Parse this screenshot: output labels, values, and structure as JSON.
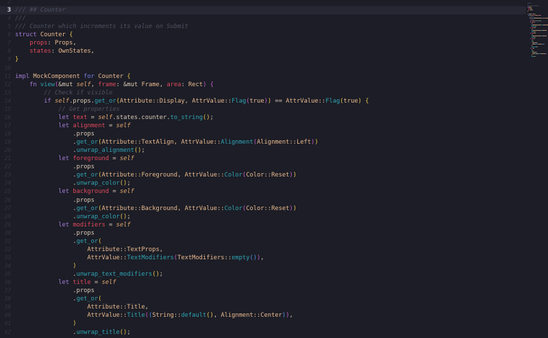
{
  "editor": {
    "current_line": 3,
    "lines": [
      {
        "n": "2",
        "tokens": []
      },
      {
        "n": "3",
        "tokens": [
          [
            "c",
            "/// ## Counter"
          ]
        ]
      },
      {
        "n": "4",
        "tokens": [
          [
            "c",
            "///"
          ]
        ]
      },
      {
        "n": "5",
        "tokens": [
          [
            "c",
            "/// Counter which increments its value on Submit"
          ]
        ]
      },
      {
        "n": "6",
        "tokens": [
          [
            "k",
            "struct"
          ],
          [
            "p",
            " "
          ],
          [
            "t",
            "Counter"
          ],
          [
            "p",
            " "
          ],
          [
            "b1",
            "{"
          ]
        ]
      },
      {
        "n": "7",
        "tokens": [
          [
            "p",
            "    "
          ],
          [
            "f",
            "props"
          ],
          [
            "p",
            ": "
          ],
          [
            "t",
            "Props"
          ],
          [
            "p",
            ","
          ]
        ]
      },
      {
        "n": "8",
        "tokens": [
          [
            "p",
            "    "
          ],
          [
            "f",
            "states"
          ],
          [
            "p",
            ": "
          ],
          [
            "t",
            "OwnStates"
          ],
          [
            "p",
            ","
          ]
        ]
      },
      {
        "n": "9",
        "tokens": [
          [
            "b1",
            "}"
          ]
        ]
      },
      {
        "n": "10",
        "tokens": []
      },
      {
        "n": "11",
        "tokens": [
          [
            "k",
            "impl"
          ],
          [
            "p",
            " "
          ],
          [
            "t",
            "MockComponent"
          ],
          [
            "p",
            " "
          ],
          [
            "k2",
            "for"
          ],
          [
            "p",
            " "
          ],
          [
            "t",
            "Counter"
          ],
          [
            "p",
            " "
          ],
          [
            "b1",
            "{"
          ]
        ]
      },
      {
        "n": "12",
        "tokens": [
          [
            "p",
            "    "
          ],
          [
            "k",
            "fn"
          ],
          [
            "p",
            " "
          ],
          [
            "m",
            "view"
          ],
          [
            "b2",
            "("
          ],
          [
            "p",
            "&mut "
          ],
          [
            "s",
            "self"
          ],
          [
            "p",
            ", "
          ],
          [
            "f",
            "frame"
          ],
          [
            "p",
            ": &mut "
          ],
          [
            "t",
            "Frame"
          ],
          [
            "p",
            ", "
          ],
          [
            "f",
            "area"
          ],
          [
            "p",
            ": "
          ],
          [
            "t",
            "Rect"
          ],
          [
            "b2",
            ")"
          ],
          [
            "p",
            " "
          ],
          [
            "b2",
            "{"
          ]
        ]
      },
      {
        "n": "13",
        "tokens": [
          [
            "p",
            "        "
          ],
          [
            "c",
            "// Check if visible"
          ]
        ]
      },
      {
        "n": "14",
        "tokens": [
          [
            "p",
            "        "
          ],
          [
            "k",
            "if"
          ],
          [
            "p",
            " "
          ],
          [
            "s",
            "self"
          ],
          [
            "p",
            ".props."
          ],
          [
            "m",
            "get_or"
          ],
          [
            "b1",
            "("
          ],
          [
            "t",
            "Attribute::Display, AttrValue::"
          ],
          [
            "m",
            "Flag"
          ],
          [
            "b2",
            "("
          ],
          [
            "t",
            "true"
          ],
          [
            "b2",
            ")"
          ],
          [
            "b1",
            ")"
          ],
          [
            "p",
            " == "
          ],
          [
            "t",
            "AttrValue::"
          ],
          [
            "m",
            "Flag"
          ],
          [
            "b1",
            "("
          ],
          [
            "t",
            "true"
          ],
          [
            "b1",
            ")"
          ],
          [
            "p",
            " "
          ],
          [
            "b1",
            "{"
          ]
        ]
      },
      {
        "n": "15",
        "tokens": [
          [
            "p",
            "            "
          ],
          [
            "c",
            "// Get properties"
          ]
        ]
      },
      {
        "n": "16",
        "tokens": [
          [
            "p",
            "            "
          ],
          [
            "k",
            "let"
          ],
          [
            "p",
            " "
          ],
          [
            "f",
            "text"
          ],
          [
            "p",
            " = "
          ],
          [
            "s",
            "self"
          ],
          [
            "p",
            ".states.counter."
          ],
          [
            "m",
            "to_string"
          ],
          [
            "b1",
            "()"
          ],
          [
            "p",
            ";"
          ]
        ]
      },
      {
        "n": "17",
        "tokens": [
          [
            "p",
            "            "
          ],
          [
            "k",
            "let"
          ],
          [
            "p",
            " "
          ],
          [
            "f",
            "alignment"
          ],
          [
            "p",
            " = "
          ],
          [
            "s",
            "self"
          ]
        ]
      },
      {
        "n": "18",
        "tokens": [
          [
            "p",
            "                .props"
          ]
        ]
      },
      {
        "n": "19",
        "tokens": [
          [
            "p",
            "                ."
          ],
          [
            "m",
            "get_or"
          ],
          [
            "b1",
            "("
          ],
          [
            "t",
            "Attribute::TextAlign, AttrValue::"
          ],
          [
            "m",
            "Alignment"
          ],
          [
            "b2",
            "("
          ],
          [
            "t",
            "Alignment::Left"
          ],
          [
            "b2",
            ")"
          ],
          [
            "b1",
            ")"
          ]
        ]
      },
      {
        "n": "20",
        "tokens": [
          [
            "p",
            "                ."
          ],
          [
            "m",
            "unwrap_alignment"
          ],
          [
            "b1",
            "()"
          ],
          [
            "p",
            ";"
          ]
        ]
      },
      {
        "n": "21",
        "tokens": [
          [
            "p",
            "            "
          ],
          [
            "k",
            "let"
          ],
          [
            "p",
            " "
          ],
          [
            "f",
            "foreground"
          ],
          [
            "p",
            " = "
          ],
          [
            "s",
            "self"
          ]
        ]
      },
      {
        "n": "22",
        "tokens": [
          [
            "p",
            "                .props"
          ]
        ]
      },
      {
        "n": "23",
        "tokens": [
          [
            "p",
            "                ."
          ],
          [
            "m",
            "get_or"
          ],
          [
            "b1",
            "("
          ],
          [
            "t",
            "Attribute::Foreground, AttrValue::"
          ],
          [
            "m",
            "Color"
          ],
          [
            "b2",
            "("
          ],
          [
            "t",
            "Color::Reset"
          ],
          [
            "b2",
            ")"
          ],
          [
            "b1",
            ")"
          ]
        ]
      },
      {
        "n": "24",
        "tokens": [
          [
            "p",
            "                ."
          ],
          [
            "m",
            "unwrap_color"
          ],
          [
            "b1",
            "()"
          ],
          [
            "p",
            ";"
          ]
        ]
      },
      {
        "n": "25",
        "tokens": [
          [
            "p",
            "            "
          ],
          [
            "k",
            "let"
          ],
          [
            "p",
            " "
          ],
          [
            "f",
            "background"
          ],
          [
            "p",
            " = "
          ],
          [
            "s",
            "self"
          ]
        ]
      },
      {
        "n": "26",
        "tokens": [
          [
            "p",
            "                .props"
          ]
        ]
      },
      {
        "n": "27",
        "tokens": [
          [
            "p",
            "                ."
          ],
          [
            "m",
            "get_or"
          ],
          [
            "b1",
            "("
          ],
          [
            "t",
            "Attribute::Background, AttrValue::"
          ],
          [
            "m",
            "Color"
          ],
          [
            "b2",
            "("
          ],
          [
            "t",
            "Color::Reset"
          ],
          [
            "b2",
            ")"
          ],
          [
            "b1",
            ")"
          ]
        ]
      },
      {
        "n": "28",
        "tokens": [
          [
            "p",
            "                ."
          ],
          [
            "m",
            "unwrap_color"
          ],
          [
            "b1",
            "()"
          ],
          [
            "p",
            ";"
          ]
        ]
      },
      {
        "n": "29",
        "tokens": [
          [
            "p",
            "            "
          ],
          [
            "k",
            "let"
          ],
          [
            "p",
            " "
          ],
          [
            "f",
            "modifiers"
          ],
          [
            "p",
            " = "
          ],
          [
            "s",
            "self"
          ]
        ]
      },
      {
        "n": "30",
        "tokens": [
          [
            "p",
            "                .props"
          ]
        ]
      },
      {
        "n": "31",
        "tokens": [
          [
            "p",
            "                ."
          ],
          [
            "m",
            "get_or"
          ],
          [
            "b1",
            "("
          ]
        ]
      },
      {
        "n": "32",
        "tokens": [
          [
            "t",
            "                    Attribute::TextProps"
          ],
          [
            "p",
            ","
          ]
        ]
      },
      {
        "n": "33",
        "tokens": [
          [
            "t",
            "                    AttrValue::"
          ],
          [
            "m",
            "TextModifiers"
          ],
          [
            "b2",
            "("
          ],
          [
            "t",
            "TextModifiers::"
          ],
          [
            "m",
            "empty"
          ],
          [
            "b3",
            "()"
          ],
          [
            "b2",
            ")"
          ],
          [
            "p",
            ","
          ]
        ]
      },
      {
        "n": "34",
        "tokens": [
          [
            "p",
            "                "
          ],
          [
            "b1",
            ")"
          ]
        ]
      },
      {
        "n": "35",
        "tokens": [
          [
            "p",
            "                ."
          ],
          [
            "m",
            "unwrap_text_modifiers"
          ],
          [
            "b1",
            "()"
          ],
          [
            "p",
            ";"
          ]
        ]
      },
      {
        "n": "36",
        "tokens": [
          [
            "p",
            "            "
          ],
          [
            "k",
            "let"
          ],
          [
            "p",
            " "
          ],
          [
            "f",
            "title"
          ],
          [
            "p",
            " = "
          ],
          [
            "s",
            "self"
          ]
        ]
      },
      {
        "n": "37",
        "tokens": [
          [
            "p",
            "                .props"
          ]
        ]
      },
      {
        "n": "38",
        "tokens": [
          [
            "p",
            "                ."
          ],
          [
            "m",
            "get_or"
          ],
          [
            "b1",
            "("
          ]
        ]
      },
      {
        "n": "39",
        "tokens": [
          [
            "t",
            "                    Attribute::Title"
          ],
          [
            "p",
            ","
          ]
        ]
      },
      {
        "n": "40",
        "tokens": [
          [
            "t",
            "                    AttrValue::"
          ],
          [
            "m",
            "Title"
          ],
          [
            "b2",
            "("
          ],
          [
            "b3",
            "("
          ],
          [
            "t",
            "String::"
          ],
          [
            "m",
            "default"
          ],
          [
            "b1",
            "()"
          ],
          [
            "p",
            ", "
          ],
          [
            "t",
            "Alignment::Center"
          ],
          [
            "b3",
            ")"
          ],
          [
            "b2",
            ")"
          ],
          [
            "p",
            ","
          ]
        ]
      },
      {
        "n": "41",
        "tokens": [
          [
            "p",
            "                "
          ],
          [
            "b1",
            ")"
          ]
        ]
      },
      {
        "n": "42",
        "tokens": [
          [
            "p",
            "                ."
          ],
          [
            "m",
            "unwrap_title"
          ],
          [
            "b1",
            "()"
          ],
          [
            "p",
            ";"
          ]
        ]
      }
    ]
  }
}
